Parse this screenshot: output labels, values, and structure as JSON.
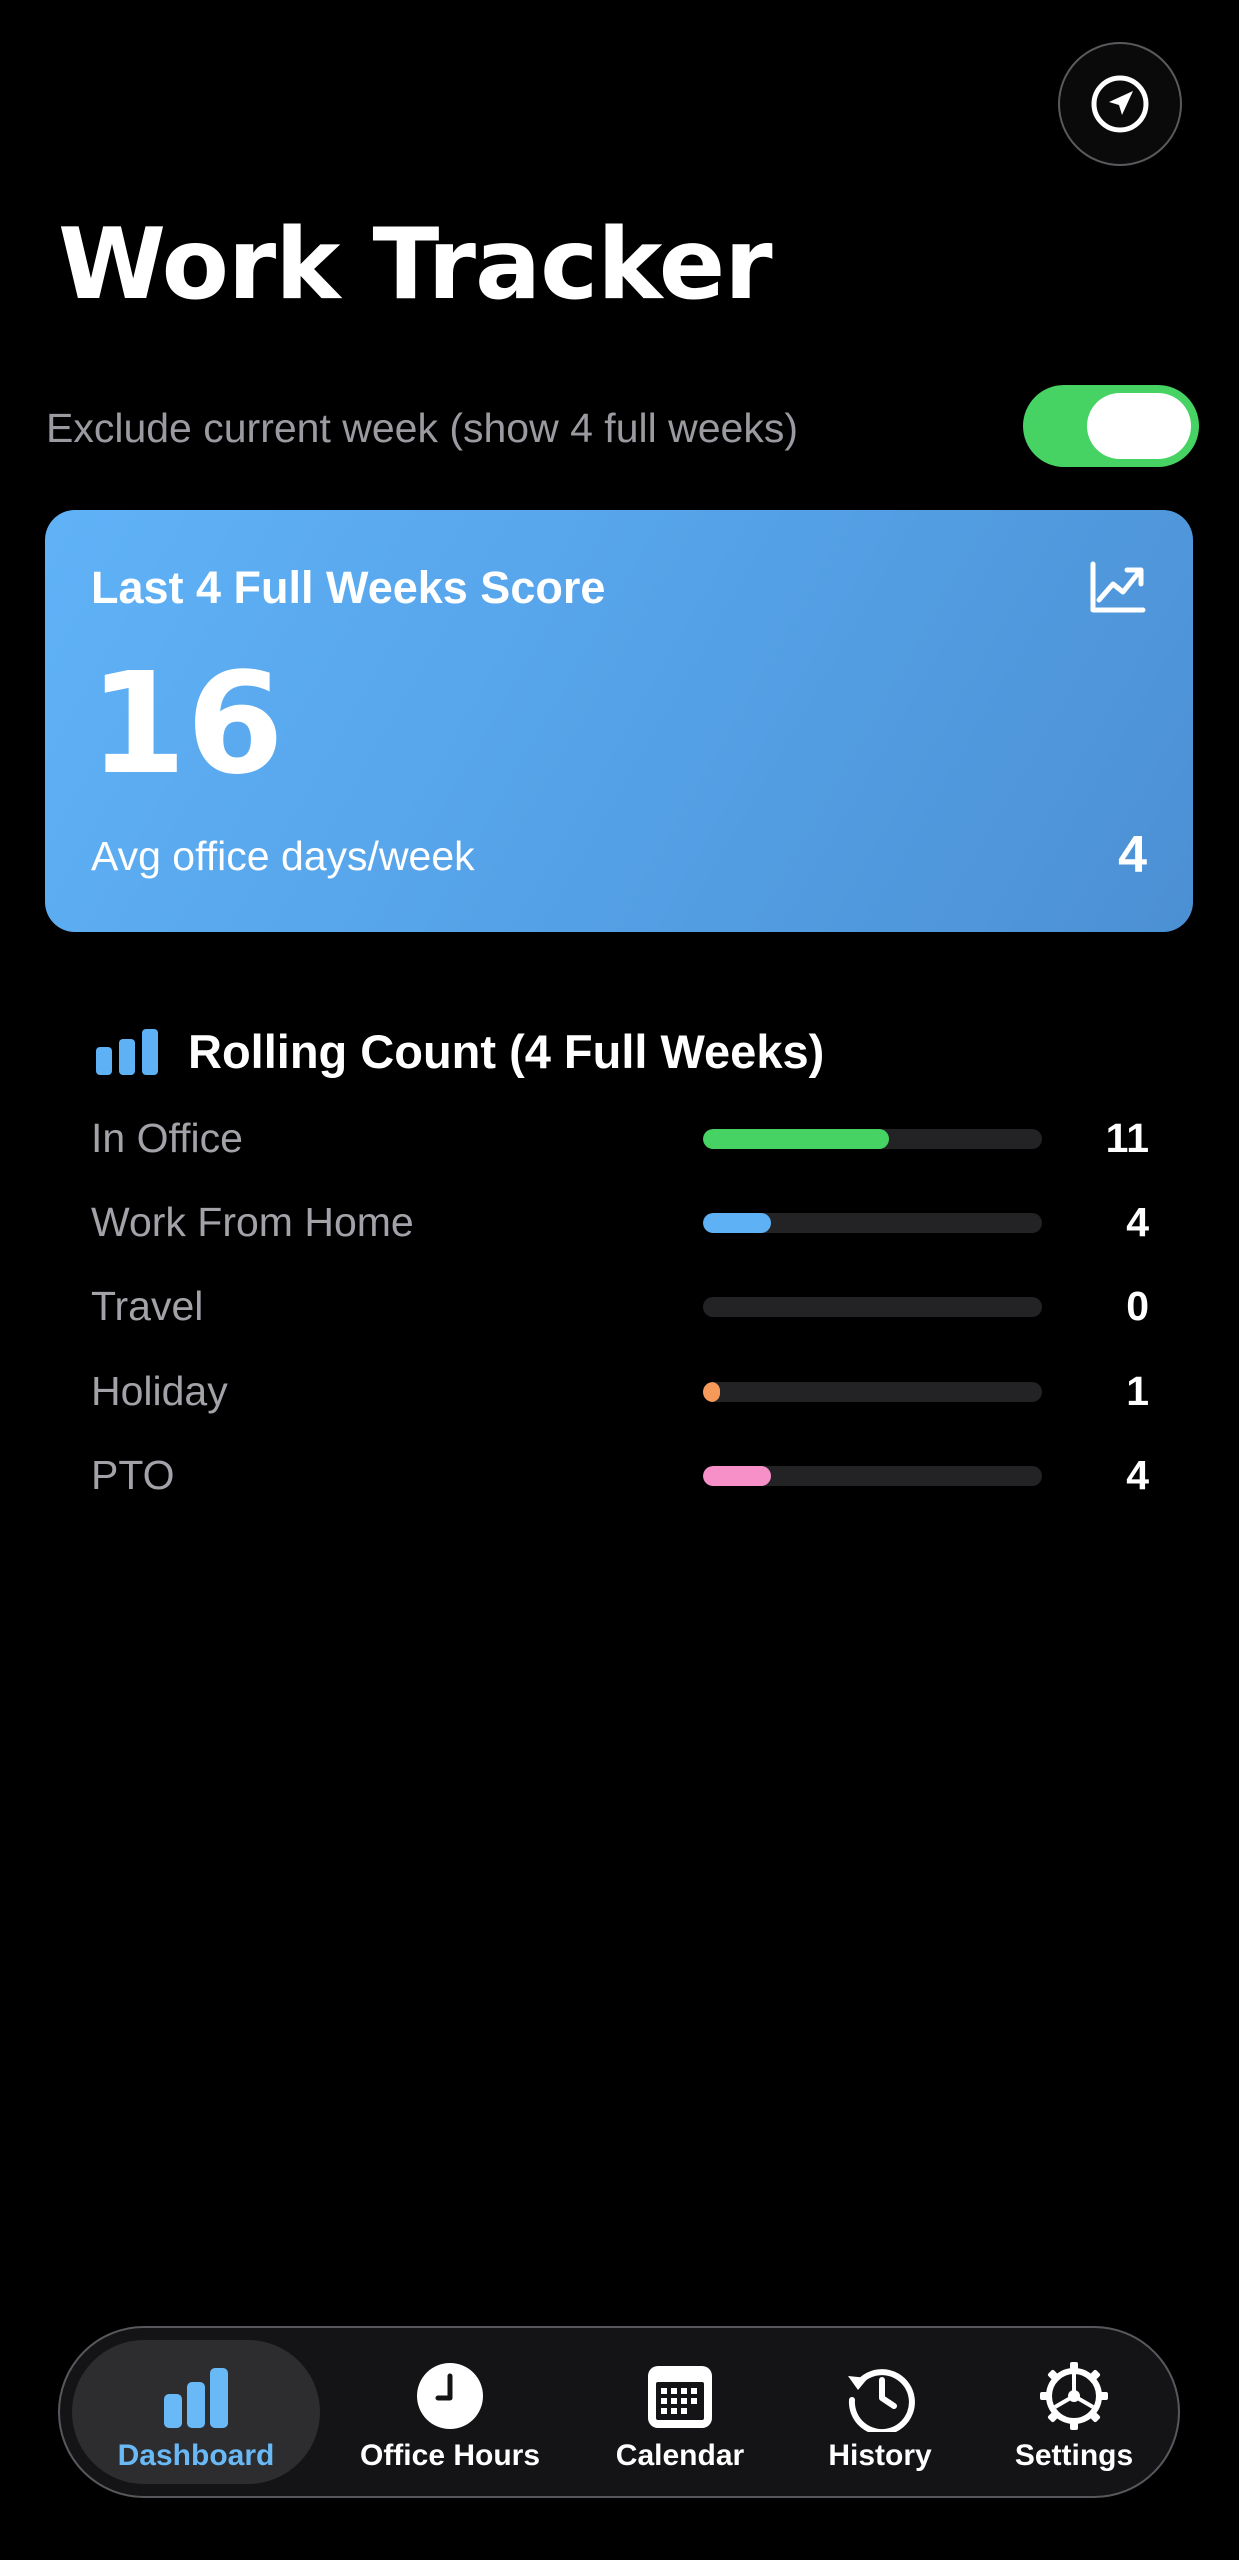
{
  "header": {
    "title": "Work Tracker"
  },
  "toggle": {
    "label": "Exclude current week (show 4 full weeks)",
    "on": true
  },
  "score_card": {
    "title": "Last 4 Full Weeks Score",
    "score": "16",
    "avg_label": "Avg office days/week",
    "avg_value": "4"
  },
  "rolling_count": {
    "title": "Rolling Count (4 Full Weeks)",
    "max": 20,
    "rows": [
      {
        "label": "In Office",
        "value": "11",
        "count": 11,
        "color": "#46d363"
      },
      {
        "label": "Work From Home",
        "value": "4",
        "count": 4,
        "color": "#5fb1f6"
      },
      {
        "label": "Travel",
        "value": "0",
        "count": 0,
        "color": "#a98bf0"
      },
      {
        "label": "Holiday",
        "value": "1",
        "count": 1,
        "color": "#f59a5a"
      },
      {
        "label": "PTO",
        "value": "4",
        "count": 4,
        "color": "#f790c8"
      }
    ]
  },
  "tabs": [
    {
      "label": "Dashboard",
      "icon": "bar-chart-icon",
      "active": true
    },
    {
      "label": "Office Hours",
      "icon": "clock-icon",
      "active": false
    },
    {
      "label": "Calendar",
      "icon": "calendar-icon",
      "active": false
    },
    {
      "label": "History",
      "icon": "history-icon",
      "active": false
    },
    {
      "label": "Settings",
      "icon": "gear-icon",
      "active": false
    }
  ],
  "colors": {
    "accent": "#6ab9f7",
    "toggle_on": "#46d363",
    "card_gradient_start": "#60b2f7",
    "card_gradient_end": "#4c90d3"
  }
}
